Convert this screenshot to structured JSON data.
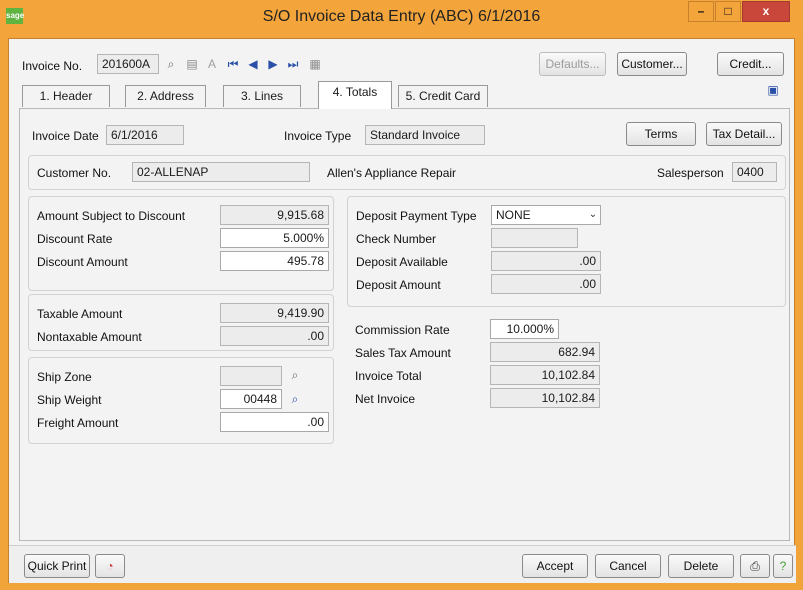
{
  "window": {
    "title": "S/O Invoice Data Entry (ABC) 6/1/2016",
    "logo": "sage",
    "min": "–",
    "max": "□",
    "close": "x"
  },
  "toolbar": {
    "invoice_no_label": "Invoice No.",
    "invoice_no_value": "201600A",
    "defaults": "Defaults...",
    "customer": "Customer...",
    "credit": "Credit..."
  },
  "tabs": [
    "1. Header",
    "2. Address",
    "3. Lines",
    "4. Totals",
    "5. Credit Card"
  ],
  "summary": {
    "invoice_date_label": "Invoice Date",
    "invoice_date": "6/1/2016",
    "invoice_type_label": "Invoice Type",
    "invoice_type": "Standard Invoice",
    "terms": "Terms",
    "tax_detail": "Tax Detail..."
  },
  "customer": {
    "label": "Customer No.",
    "number": "02-ALLENAP",
    "name": "Allen's Appliance Repair",
    "salesperson_label": "Salesperson",
    "salesperson": "0400"
  },
  "discount": {
    "amount_subject_label": "Amount Subject to Discount",
    "amount_subject": "9,915.68",
    "rate_label": "Discount Rate",
    "rate": "5.000%",
    "amount_label": "Discount Amount",
    "amount": "495.78"
  },
  "tax": {
    "taxable_label": "Taxable Amount",
    "taxable": "9,419.90",
    "nontaxable_label": "Nontaxable Amount",
    "nontaxable": ".00"
  },
  "shipping": {
    "zone_label": "Ship Zone",
    "zone": "",
    "weight_label": "Ship Weight",
    "weight": "00448",
    "freight_label": "Freight Amount",
    "freight": ".00"
  },
  "deposit": {
    "payment_type_label": "Deposit Payment Type",
    "payment_type": "NONE",
    "check_label": "Check Number",
    "check": "",
    "available_label": "Deposit Available",
    "available": ".00",
    "amount_label": "Deposit Amount",
    "amount": ".00"
  },
  "totals": {
    "commission_label": "Commission Rate",
    "commission": "10.000%",
    "sales_tax_label": "Sales Tax Amount",
    "sales_tax": "682.94",
    "invoice_total_label": "Invoice Total",
    "invoice_total": "10,102.84",
    "net_invoice_label": "Net Invoice",
    "net_invoice": "10,102.84"
  },
  "footer": {
    "quick_print": "Quick Print",
    "accept": "Accept",
    "cancel": "Cancel",
    "delete": "Delete"
  },
  "colors": {
    "titlebar": "#f3a53b",
    "close": "#c9463b",
    "navigation": "#2a4fa8"
  }
}
